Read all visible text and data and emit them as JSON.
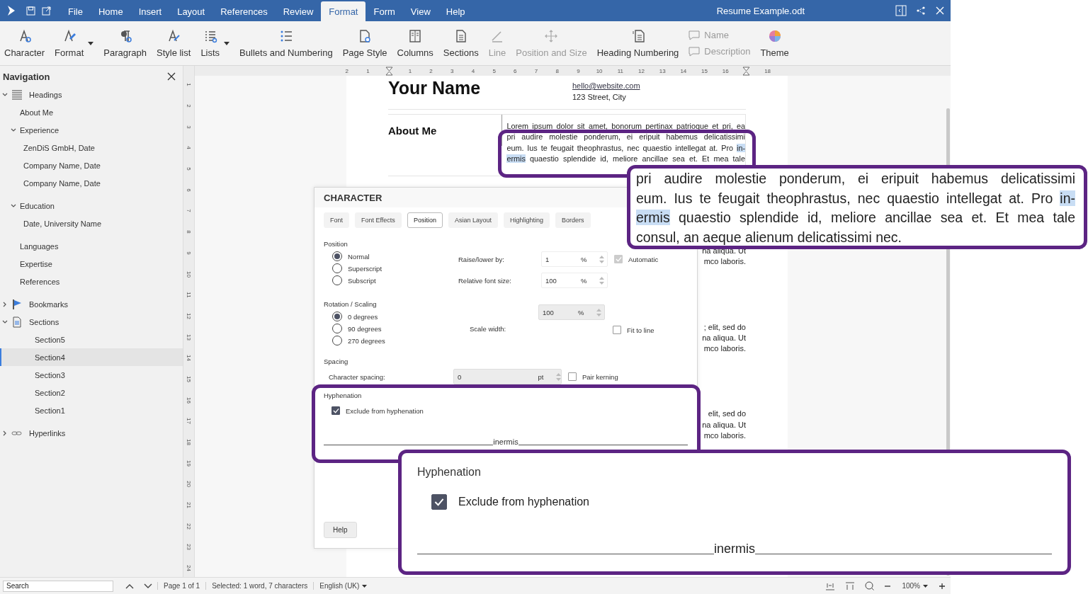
{
  "window": {
    "title": "Resume Example.odt"
  },
  "menu": [
    {
      "label": "File",
      "selected": false
    },
    {
      "label": "Home",
      "selected": false
    },
    {
      "label": "Insert",
      "selected": false
    },
    {
      "label": "Layout",
      "selected": false
    },
    {
      "label": "References",
      "selected": false
    },
    {
      "label": "Review",
      "selected": false
    },
    {
      "label": "Format",
      "selected": true
    },
    {
      "label": "Form",
      "selected": false
    },
    {
      "label": "View",
      "selected": false
    },
    {
      "label": "Help",
      "selected": false
    }
  ],
  "toolbar": [
    {
      "kind": "button",
      "label": "Character",
      "disabled": false,
      "dropdown": false
    },
    {
      "kind": "button",
      "label": "Format",
      "disabled": false,
      "dropdown": true
    },
    {
      "kind": "button",
      "label": "Paragraph",
      "disabled": false,
      "dropdown": false
    },
    {
      "kind": "button",
      "label": "Style list",
      "disabled": false,
      "dropdown": false
    },
    {
      "kind": "button",
      "label": "Lists",
      "disabled": false,
      "dropdown": true
    },
    {
      "kind": "button",
      "label": "Bullets and Numbering",
      "disabled": false,
      "dropdown": false
    },
    {
      "kind": "button",
      "label": "Page Style",
      "disabled": false,
      "dropdown": false
    },
    {
      "kind": "button",
      "label": "Columns",
      "disabled": false,
      "dropdown": false
    },
    {
      "kind": "button",
      "label": "Sections",
      "disabled": false,
      "dropdown": false
    },
    {
      "kind": "button",
      "label": "Line",
      "disabled": true,
      "dropdown": false
    },
    {
      "kind": "button",
      "label": "Position and Size",
      "disabled": true,
      "dropdown": false
    },
    {
      "kind": "button",
      "label": "Heading Numbering",
      "disabled": false,
      "dropdown": false
    },
    {
      "kind": "pair",
      "items": [
        {
          "label": "Name",
          "disabled": true
        },
        {
          "label": "Description",
          "disabled": true
        }
      ]
    },
    {
      "kind": "button",
      "label": "Theme",
      "disabled": false,
      "dropdown": false
    }
  ],
  "navigation": {
    "title": "Navigation",
    "tree": [
      {
        "label": "Headings",
        "expanded": true,
        "selected": false,
        "children": [
          {
            "label": "About Me",
            "selected": false
          },
          {
            "label": "Experience",
            "expanded": true,
            "selected": false,
            "children": [
              {
                "label": "ZenDiS GmbH, Date",
                "selected": false
              },
              {
                "label": "Company Name, Date",
                "selected": false
              },
              {
                "label": "Company Name, Date",
                "selected": false
              }
            ]
          },
          {
            "label": "Education",
            "expanded": true,
            "selected": false,
            "children": [
              {
                "label": "Date, University Name",
                "selected": false
              }
            ]
          },
          {
            "label": "Languages",
            "selected": false
          },
          {
            "label": "Expertise",
            "selected": false
          },
          {
            "label": "References",
            "selected": false
          }
        ]
      },
      {
        "label": "Bookmarks",
        "expanded": false,
        "selected": false
      },
      {
        "label": "Sections",
        "expanded": true,
        "selected": false,
        "children": [
          {
            "label": "Section5",
            "selected": false
          },
          {
            "label": "Section4",
            "selected": true
          },
          {
            "label": "Section3",
            "selected": false
          },
          {
            "label": "Section2",
            "selected": false
          },
          {
            "label": "Section1",
            "selected": false
          }
        ]
      },
      {
        "label": "Hyperlinks",
        "expanded": false,
        "selected": false
      }
    ]
  },
  "rulers": {
    "horizontal": [
      {
        "kind": "number",
        "label": "2"
      },
      {
        "kind": "number",
        "label": "1"
      },
      {
        "kind": "marker"
      },
      {
        "kind": "number",
        "label": "1"
      },
      {
        "kind": "number",
        "label": "2"
      },
      {
        "kind": "number",
        "label": "3"
      },
      {
        "kind": "number",
        "label": "4"
      },
      {
        "kind": "number",
        "label": "5"
      },
      {
        "kind": "number",
        "label": "6"
      },
      {
        "kind": "number",
        "label": "7"
      },
      {
        "kind": "number",
        "label": "8"
      },
      {
        "kind": "number",
        "label": "9"
      },
      {
        "kind": "number",
        "label": "10"
      },
      {
        "kind": "number",
        "label": "11"
      },
      {
        "kind": "number",
        "label": "12"
      },
      {
        "kind": "number",
        "label": "13"
      },
      {
        "kind": "number",
        "label": "14"
      },
      {
        "kind": "number",
        "label": "15"
      },
      {
        "kind": "number",
        "label": "16"
      },
      {
        "kind": "marker"
      },
      {
        "kind": "number",
        "label": "18"
      }
    ],
    "vertical": [
      "1",
      "2",
      "3",
      "4",
      "5",
      "6",
      "7",
      "8",
      "9",
      "10",
      "11",
      "12",
      "13",
      "14",
      "15",
      "16",
      "17",
      "18",
      "19",
      "20",
      "21",
      "22",
      "23",
      "24"
    ]
  },
  "document": {
    "name": "Your Name",
    "contact": [
      {
        "kind": "link",
        "text": "hello@website.com"
      },
      {
        "kind": "text",
        "text": "123 Street, City"
      }
    ],
    "section_title": "About Me",
    "lines": [
      [
        {
          "text": "Lorem ipsum dolor sit amet, bonorum pertinax patrioque et pri, ea",
          "highlighted": false
        }
      ],
      [
        {
          "text": "pri audire molestie ponderum, ei eripuit habemus delicatissimi",
          "highlighted": false
        }
      ],
      [
        {
          "text": "eum. Ius te feugait theophrastus, nec quaestio intellegat at. Pro ",
          "highlighted": false
        },
        {
          "text": "in-",
          "highlighted": true
        }
      ],
      [
        {
          "text": "ermis",
          "highlighted": true
        },
        {
          "text": " quaestio splendide id, meliore ancillae sea et. Et mea tale",
          "highlighted": false
        }
      ]
    ],
    "fragments": [
      [
        "na aliqua. Ut",
        "mco laboris."
      ],
      [
        "; elit, sed do",
        "na aliqua. Ut",
        "mco laboris."
      ],
      [
        "elit, sed do",
        "na aliqua. Ut",
        "mco laboris."
      ]
    ]
  },
  "dialog": {
    "title": "CHARACTER",
    "tabs": [
      {
        "label": "Font",
        "selected": false
      },
      {
        "label": "Font Effects",
        "selected": false
      },
      {
        "label": "Position",
        "selected": true
      },
      {
        "label": "Asian Layout",
        "selected": false
      },
      {
        "label": "Highlighting",
        "selected": false
      },
      {
        "label": "Borders",
        "selected": false
      }
    ],
    "position": {
      "label": "Position",
      "options": [
        {
          "label": "Normal",
          "selected": true
        },
        {
          "label": "Superscript",
          "selected": false
        },
        {
          "label": "Subscript",
          "selected": false
        }
      ],
      "raise": {
        "label": "Raise/lower by:",
        "value": "1",
        "unit": "%",
        "disabled": false
      },
      "automatic": {
        "label": "Automatic",
        "checked": true,
        "disabled": true
      },
      "relative": {
        "label": "Relative font size:",
        "value": "100",
        "unit": "%",
        "disabled": false
      }
    },
    "rotation": {
      "label": "Rotation / Scaling",
      "options": [
        {
          "label": "0 degrees",
          "selected": true
        },
        {
          "label": "90 degrees",
          "selected": false
        },
        {
          "label": "270 degrees",
          "selected": false
        }
      ],
      "scale": {
        "label": "Scale width:",
        "value": "100",
        "unit": "%",
        "disabled": true
      },
      "fit": {
        "label": "Fit to line",
        "checked": false,
        "disabled": false
      }
    },
    "spacing": {
      "label": "Spacing",
      "field": {
        "label": "Character spacing:",
        "value": "0",
        "unit": "pt",
        "disabled": true
      },
      "kerning": {
        "label": "Pair kerning",
        "checked": false,
        "disabled": false
      }
    },
    "hyphenation": {
      "label": "Hyphenation",
      "exclude": {
        "label": "Exclude from hyphenation",
        "checked": true,
        "disabled": false
      },
      "preview": "inermis"
    },
    "help": "Help"
  },
  "callouts": [
    {
      "kind": "text",
      "lines": [
        [
          {
            "text": "pri audire molestie ponderum, ei eripuit habemus delicatissimi",
            "highlighted": false
          }
        ],
        [
          {
            "text": "eum. Ius te feugait theophrastus, nec quaestio intellegat at. Pro ",
            "highlighted": false
          },
          {
            "text": "in-",
            "highlighted": true
          }
        ],
        [
          {
            "text": "ermis",
            "highlighted": true
          },
          {
            "text": " quaestio splendide id, meliore ancillae sea et. Et mea tale",
            "highlighted": false
          }
        ],
        [
          {
            "text": "consul, an aeque alienum delicatissimi nec.",
            "highlighted": false
          }
        ]
      ]
    },
    {
      "kind": "hyphenation",
      "label": "Hyphenation",
      "checkbox": {
        "label": "Exclude from hyphenation",
        "checked": true
      },
      "preview": "inermis"
    }
  ],
  "status_bar": {
    "search": {
      "placeholder": "Search"
    },
    "page": "Page 1 of 1",
    "selection": "Selected: 1 word, 7 characters",
    "language": "English (UK)",
    "zoom": "100%"
  }
}
